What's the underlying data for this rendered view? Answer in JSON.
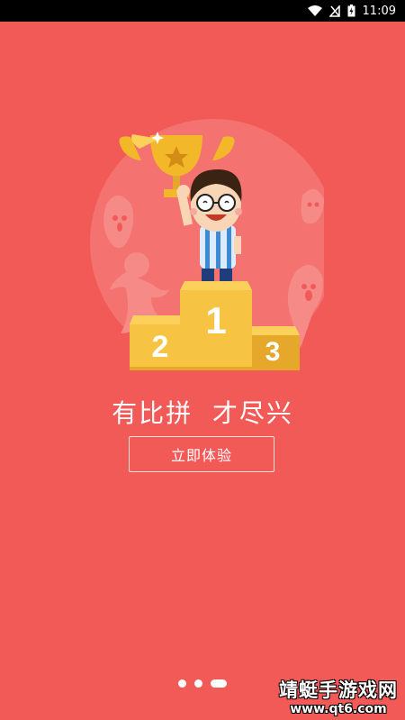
{
  "status_bar": {
    "time": "11:09",
    "icons": [
      "wifi-icon",
      "no-sim-icon",
      "battery-charging-icon"
    ]
  },
  "illustration": {
    "podium_labels": [
      "1",
      "2",
      "3"
    ],
    "description_icon": "trophy-podium-illustration"
  },
  "slogan": "有比拼  才尽兴",
  "cta_button": {
    "label": "立即体验"
  },
  "pager": {
    "count": 3,
    "active_index": 2
  },
  "watermark": {
    "title": "靖蜓手游戏网",
    "url": "www.qt6.com"
  },
  "colors": {
    "background": "#F25A58",
    "circle": "#F4726F",
    "podium": "#F7C342",
    "podium_side": "#E5A82A",
    "trophy": "#F3B829"
  }
}
